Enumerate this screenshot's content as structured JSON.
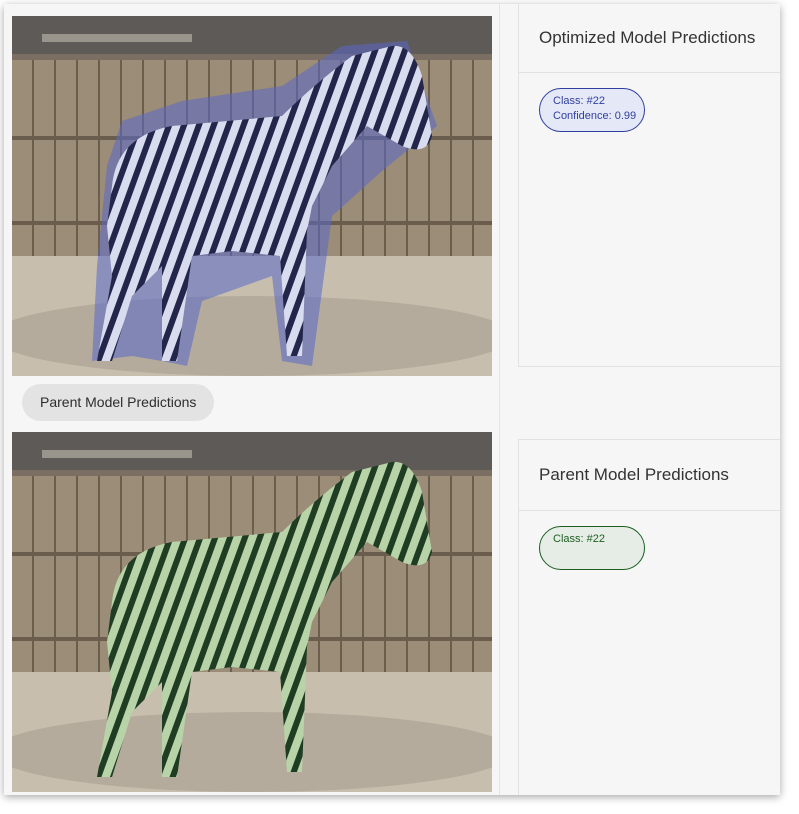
{
  "toggle": {
    "label": "Parent Model Predictions"
  },
  "panels": {
    "optimized": {
      "title": "Optimized Model Predictions",
      "prediction": {
        "class_text": "Class: #22",
        "confidence_text": "Confidence: 0.99"
      }
    },
    "parent": {
      "title": "Parent Model Predictions",
      "prediction": {
        "class_text": "Class: #22"
      }
    }
  },
  "colors": {
    "optimized_accent": "#303f9f",
    "optimized_fill": "#e5e8f7",
    "parent_accent": "#1b5e20",
    "parent_fill": "#e6ede6"
  },
  "images": {
    "top": {
      "subject": "zebra",
      "overlay": "blue-segmentation-mask"
    },
    "bottom": {
      "subject": "zebra",
      "overlay": "green-segmentation-mask"
    }
  }
}
